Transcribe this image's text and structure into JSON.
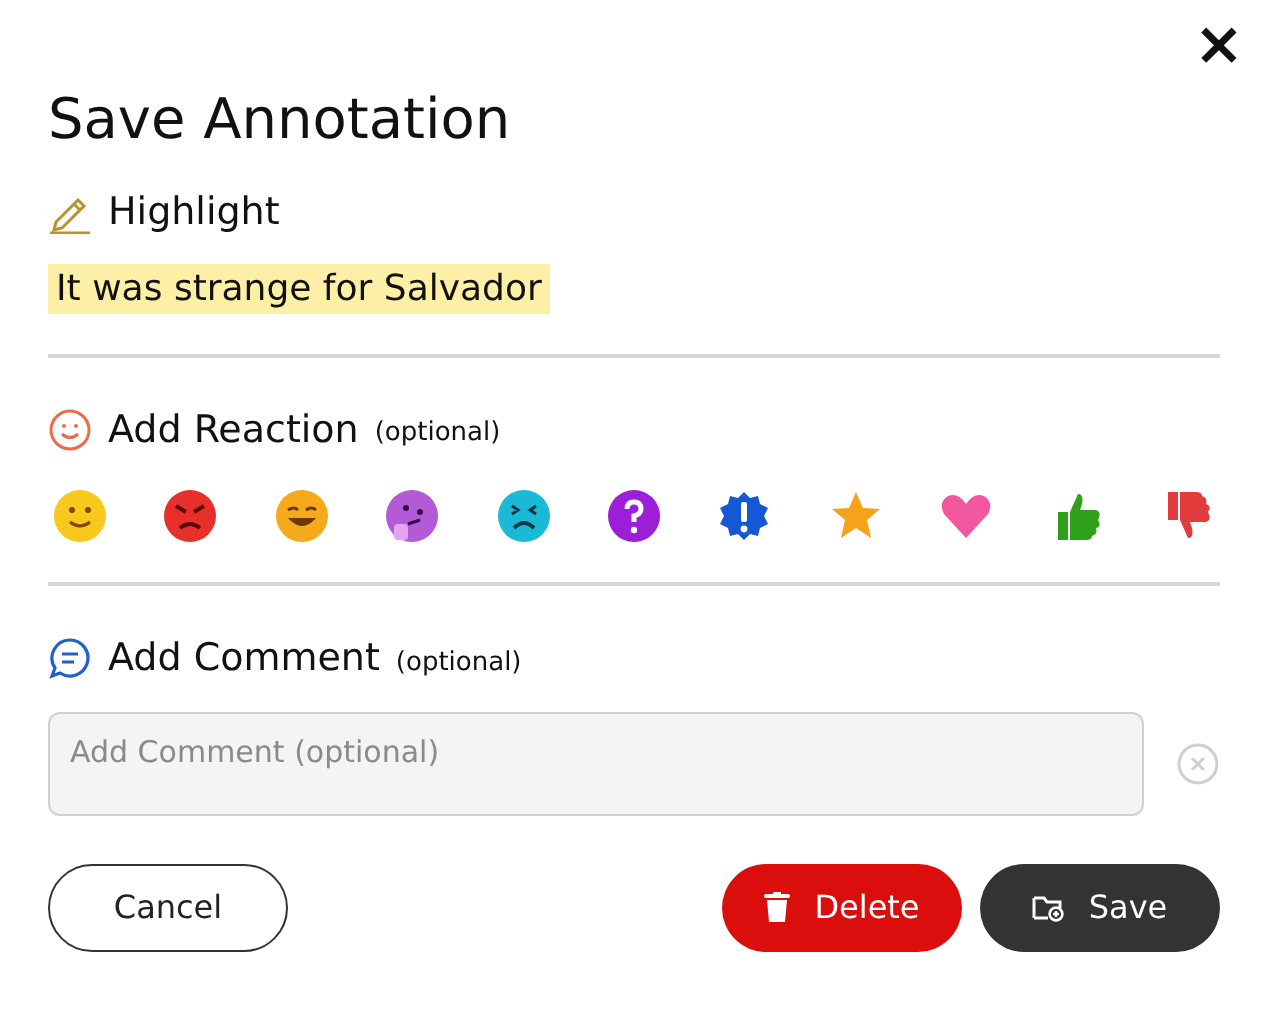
{
  "dialog": {
    "title": "Save Annotation",
    "close": "×"
  },
  "highlight": {
    "label": "Highlight",
    "text": "It was strange for Salvador"
  },
  "reaction": {
    "label": "Add Reaction",
    "hint": "(optional)",
    "reactions": [
      {
        "kind": "smile",
        "selected": false
      },
      {
        "kind": "angry",
        "selected": false
      },
      {
        "kind": "grin",
        "selected": false
      },
      {
        "kind": "thinking",
        "selected": false
      },
      {
        "kind": "sad",
        "selected": false
      },
      {
        "kind": "question",
        "selected": false
      },
      {
        "kind": "exclaim",
        "selected": false
      },
      {
        "kind": "star",
        "selected": false
      },
      {
        "kind": "heart",
        "selected": false
      },
      {
        "kind": "thumbsup",
        "selected": false
      },
      {
        "kind": "thumbsdown",
        "selected": false
      }
    ]
  },
  "comment": {
    "label": "Add Comment",
    "hint": "(optional)",
    "placeholder": "Add Comment (optional)"
  },
  "buttons": [
    {
      "kind": "cancel",
      "label": "Cancel"
    },
    {
      "kind": "delete",
      "label": "Delete"
    },
    {
      "kind": "save",
      "label": "Save"
    }
  ]
}
